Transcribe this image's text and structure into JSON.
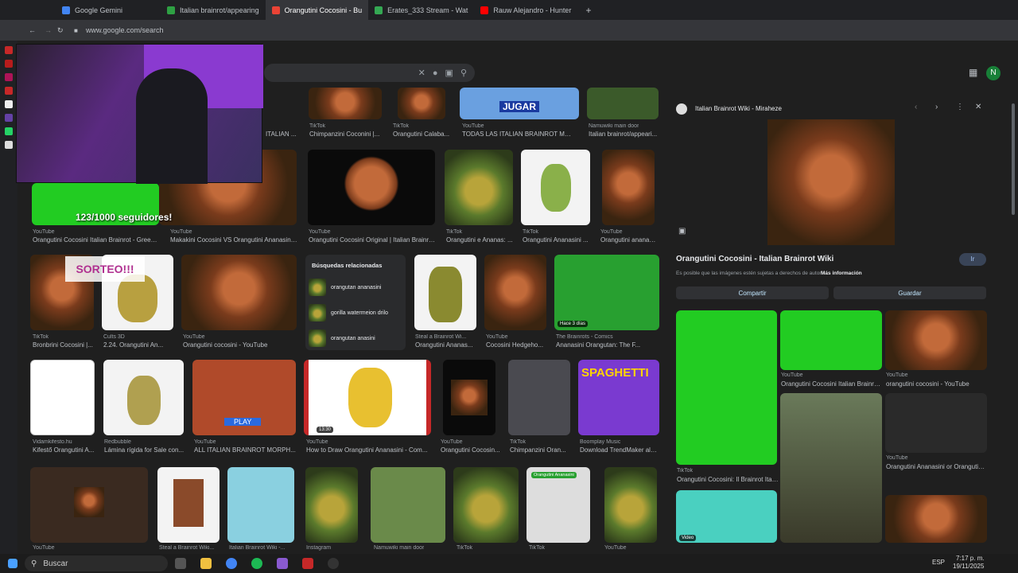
{
  "tabs": [
    {
      "label": "Google Gemini",
      "color": "#4285f4"
    },
    {
      "label": "Italian brainrot/appearing",
      "color": "#2ea043"
    },
    {
      "label": "Orangutini Cocosini - Bu",
      "color": "#ea4335",
      "active": true
    },
    {
      "label": "Erates_333 Stream - Wat",
      "color": "#34a853"
    },
    {
      "label": "Rauw Alejandro - Hunter",
      "color": "#ff0000"
    }
  ],
  "url": "www.google.com/search",
  "avatar": "N",
  "stream": {
    "followers": "123/1000 seguidores!",
    "raffle": "SORTEO!!!"
  },
  "results": {
    "row1": [
      {
        "src": "TikTok",
        "title": "ITALIAN ..."
      },
      {
        "src": "TikTok",
        "title": "Chimpanzini Coconini |..."
      },
      {
        "src": "TikTok",
        "title": "Orangutini Calaba..."
      },
      {
        "src": "YouTube",
        "title": "TODAS LAS ITALIAN BRAINROT MOR..."
      },
      {
        "src": "Namuwiki main door",
        "title": "Italian brainrot/appeari..."
      }
    ],
    "badge_jugar": "JUGAR",
    "row2": [
      {
        "src": "YouTube",
        "title": "Orangutini Cocosini Italian Brainrot - Green ..."
      },
      {
        "src": "YouTube",
        "title": "Makakini Cocosini VS Orangutini Ananasini ..."
      },
      {
        "src": "YouTube",
        "title": "Orangutini Cocosini Original | Italian Brainro..."
      },
      {
        "src": "TikTok",
        "title": "Orangutini e Ananas: ..."
      },
      {
        "src": "TikTok",
        "title": "Orangutini Ananasini ..."
      },
      {
        "src": "YouTube",
        "title": "Orangutini ananasini..."
      }
    ],
    "related": {
      "header": "Búsquedas relacionadas",
      "items": [
        "orangutan ananasini",
        "gorilla watermeion drilo",
        "orangutan anasini"
      ]
    },
    "row3": [
      {
        "src": "TikTok",
        "title": "Bronbrini Cocosini |..."
      },
      {
        "src": "Cults 3D",
        "title": "2.24. Orangutini An..."
      },
      {
        "src": "YouTube",
        "title": "Orangutini cocosini - YouTube"
      },
      {
        "src": "Steal a Brainrot Wi...",
        "title": "Orangutini Ananas..."
      },
      {
        "src": "YouTube",
        "title": "Cocosini Hedgeho..."
      },
      {
        "src": "The Brainrots - Comics",
        "title": "Ananasini Orangutan: The F..."
      }
    ],
    "row3_badge": "Hace 3 días",
    "row4": [
      {
        "src": "Vidamkifesto.hu",
        "title": "Kifestő Orangutini A..."
      },
      {
        "src": "Redbubble",
        "title": "Lámina rígida for Sale con..."
      },
      {
        "src": "YouTube",
        "title": "ALL ITALIAN BRAINROT MORPH..."
      },
      {
        "src": "YouTube",
        "title": "How to Draw Orangutini Ananasini - Com..."
      },
      {
        "src": "YouTube",
        "title": "Orangutini Cocosin..."
      },
      {
        "src": "TikTok",
        "title": "Chimpanzini Oran..."
      },
      {
        "src": "Boomplay Music",
        "title": "Download TrendMaker alb..."
      }
    ],
    "play": "PLAY",
    "duration": "13:30",
    "spaghetti": "SPAGHETTI",
    "row5": [
      {
        "src": "YouTube"
      },
      {
        "src": "Steal a Brainrot Wiki..."
      },
      {
        "src": "Italian Brainrot Wiki -..."
      },
      {
        "src": "Instagram"
      },
      {
        "src": "Namuwiki main door"
      },
      {
        "src": "TikTok"
      },
      {
        "src": "TikTok"
      },
      {
        "src": "YouTube"
      }
    ],
    "row5_chip": "Orangutini Ananasini"
  },
  "panel": {
    "site": "Italian Brainrot Wiki - Miraheze",
    "title": "Orangutini Cocosini - Italian Brainrot Wiki",
    "visit": "Ir",
    "notice": "Es posible que las imágenes estén sujetas a derechos de autor.",
    "more": "Más información",
    "share": "Compartir",
    "save": "Guardar",
    "grid": [
      {
        "src": "YouTube",
        "title": "Orangutini Cocosini Italian Brainrot - ..."
      },
      {
        "src": "YouTube",
        "title": "orangutini cocosini - YouTube"
      },
      {
        "src": "TikTok",
        "title": "Orangutini Cocosini: Il Brainrot Italiano ..."
      },
      {
        "src": "YouTube",
        "title": "Orangutini Ananasini or Orangutini..."
      }
    ],
    "video_badge": "Video"
  },
  "taskbar": {
    "search": "Buscar",
    "lang": "ESP",
    "time": "7:17 p. m.",
    "date": "19/11/2025"
  }
}
